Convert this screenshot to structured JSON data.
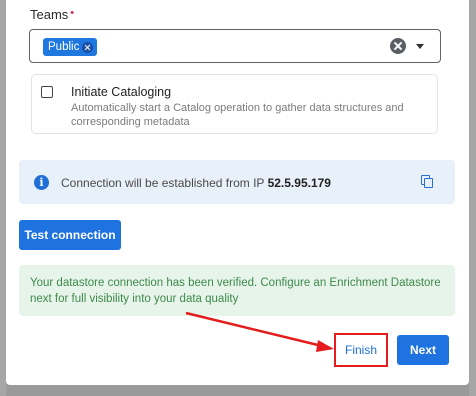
{
  "form": {
    "teams_label": "Teams",
    "required_marker": "•",
    "teams_selected": [
      "Public"
    ]
  },
  "catalog": {
    "title": "Initiate Cataloging",
    "description": "Automatically start a Catalog operation to gather data structures and corresponding metadata",
    "checked": false
  },
  "info": {
    "text": "Connection will be established from IP",
    "ip": "52.5.95.179"
  },
  "buttons": {
    "test_connection": "Test connection",
    "finish": "Finish",
    "next": "Next"
  },
  "success": {
    "message": "Your datastore connection has been verified. Configure an Enrichment Datastore next for full visibility into your data quality"
  },
  "colors": {
    "primary": "#1f73e0",
    "success_bg": "#e6f4e9",
    "success_text": "#3f8a4c",
    "info_bg": "#e8f0f9",
    "annotation_red": "#e41c1c"
  },
  "icons": {
    "chip_remove": "close-circle-icon",
    "clear": "clear-icon",
    "dropdown": "chevron-down-icon",
    "info": "info-icon",
    "copy": "copy-icon"
  }
}
